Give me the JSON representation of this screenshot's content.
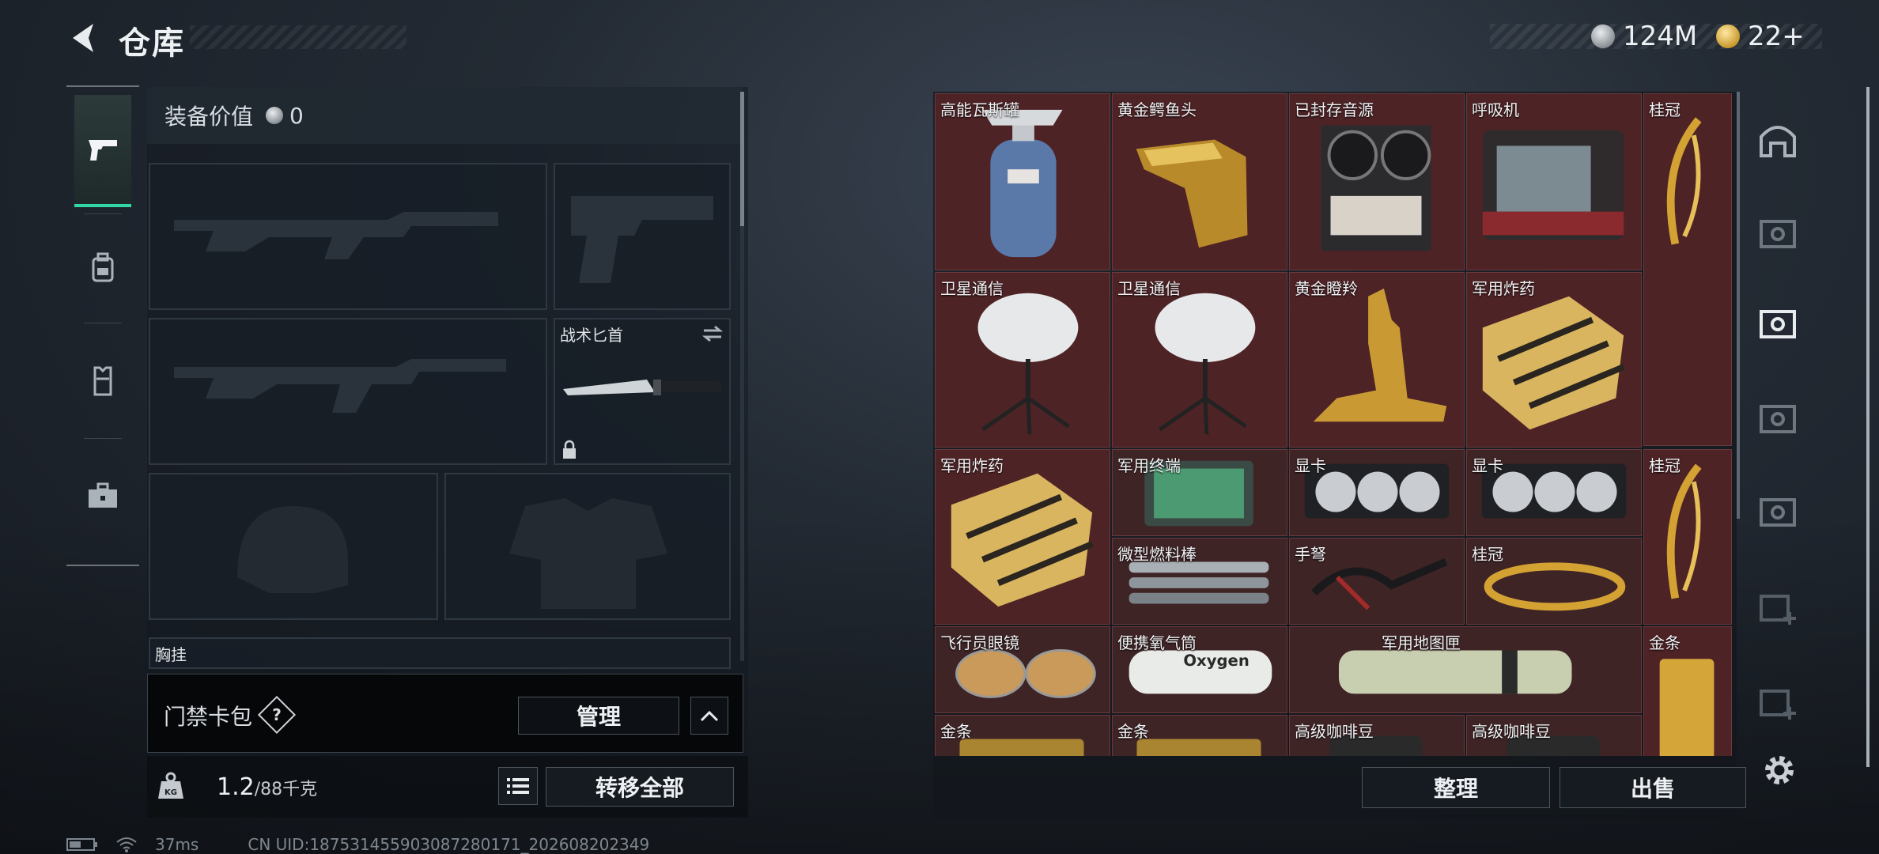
{
  "header": {
    "title": "仓库",
    "currency_silver": "124M",
    "currency_gold": "22+"
  },
  "nav": {
    "items": [
      {
        "icon": "pistol-icon",
        "active": true
      },
      {
        "icon": "backpack-icon",
        "active": false
      },
      {
        "icon": "vest-icon",
        "active": false
      },
      {
        "icon": "case-icon",
        "active": false
      }
    ]
  },
  "equipment": {
    "value_label": "装备价值",
    "value": "0",
    "knife_label": "战术匕首",
    "chest_label": "胸挂",
    "keycard_label": "门禁卡包",
    "manage_label": "管理",
    "weight_current": "1.2",
    "weight_max": "/88千克",
    "transfer_all_label": "转移全部"
  },
  "stash": {
    "items": [
      {
        "name": "高能瓦斯罐",
        "icon": "gas-canister-icon"
      },
      {
        "name": "黄金鳄鱼头",
        "icon": "gold-crocodile-head-icon"
      },
      {
        "name": "已封存音源",
        "icon": "reel-recorder-icon"
      },
      {
        "name": "呼吸机",
        "icon": "ventilator-icon"
      },
      {
        "name": "桂冠",
        "icon": "laurel-crown-icon"
      },
      {
        "name": "卫星通信",
        "icon": "satellite-dish-icon"
      },
      {
        "name": "卫星通信",
        "icon": "satellite-dish-icon"
      },
      {
        "name": "黄金瞪羚",
        "icon": "gold-gazelle-icon"
      },
      {
        "name": "军用炸药",
        "icon": "explosives-crate-icon"
      },
      {
        "name": "桂冠",
        "icon": "laurel-crown-icon"
      },
      {
        "name": "军用炸药",
        "icon": "explosives-crate-icon"
      },
      {
        "name": "军用终端",
        "icon": "military-terminal-icon"
      },
      {
        "name": "显卡",
        "icon": "graphics-card-icon"
      },
      {
        "name": "显卡",
        "icon": "graphics-card-icon"
      },
      {
        "name": "桂冠",
        "icon": "laurel-crown-icon"
      },
      {
        "name": "微型燃料棒",
        "icon": "fuel-rods-icon"
      },
      {
        "name": "手弩",
        "icon": "crossbow-icon"
      },
      {
        "name": "桂冠",
        "icon": "laurel-crown-icon"
      },
      {
        "name": "飞行员眼镜",
        "icon": "aviator-glasses-icon"
      },
      {
        "name": "便携氧气筒",
        "icon": "oxygen-tank-icon"
      },
      {
        "name": "军用地图匣",
        "icon": "map-tube-icon"
      },
      {
        "name": "金条",
        "icon": "gold-bar-icon"
      },
      {
        "name": "金条",
        "icon": "gold-bar-icon"
      },
      {
        "name": "金条",
        "icon": "gold-bar-icon"
      },
      {
        "name": "高级咖啡豆",
        "icon": "coffee-beans-icon"
      },
      {
        "name": "高级咖啡豆",
        "icon": "coffee-beans-icon"
      }
    ],
    "oxygen_text": "Oxygen",
    "sort_label": "整理",
    "sell_label": "出售"
  },
  "status": {
    "ping": "37ms",
    "uid": "CN UID:187531455903087280171_202608202349"
  },
  "colors": {
    "accent": "#33d6a6",
    "cell_bg": "#4e2326"
  }
}
